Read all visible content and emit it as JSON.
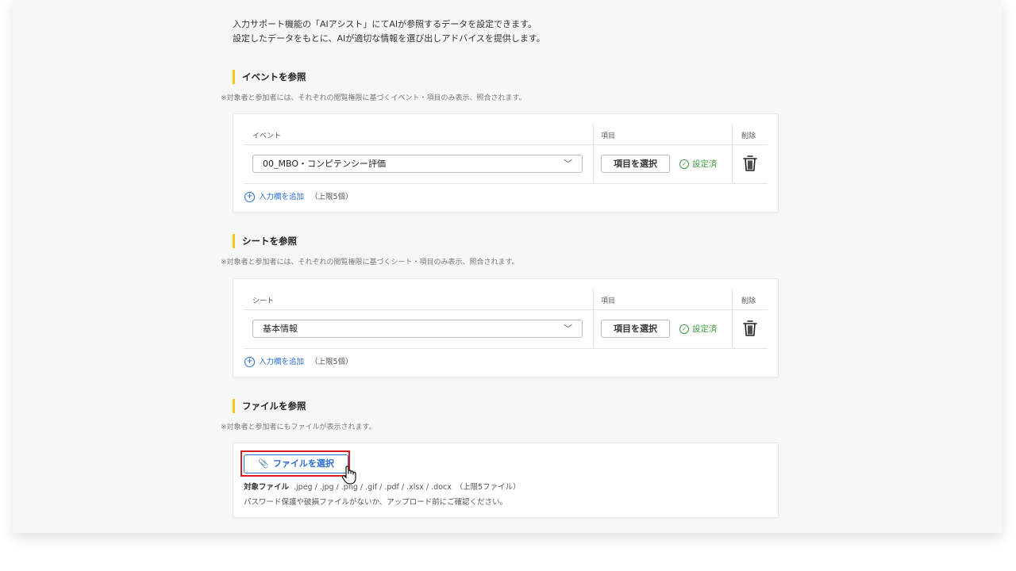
{
  "intro": {
    "line1": "入力サポート機能の「AIアシスト」にてAIが参照するデータを設定できます。",
    "line2": "設定したデータをもとに、AIが適切な情報を選び出しアドバイスを提供します。"
  },
  "event_section": {
    "title": "イベントを参照",
    "note": "※対象者と参加者には、それぞれの閲覧権限に基づくイベント・項目のみ表示、照合されます。",
    "col_main": "イベント",
    "col_item": "項目",
    "col_delete": "削除",
    "selected": "00_MBO・コンピテンシー評価",
    "item_button": "項目を選択",
    "status": "設定済",
    "add_label": "入力欄を追加",
    "limit": "（上限5個）"
  },
  "sheet_section": {
    "title": "シートを参照",
    "note": "※対象者と参加者には、それぞれの閲覧権限に基づくシート・項目のみ表示、照合されます。",
    "col_main": "シート",
    "col_item": "項目",
    "col_delete": "削除",
    "selected": "基本情報",
    "item_button": "項目を選択",
    "status": "設定済",
    "add_label": "入力欄を追加",
    "limit": "（上限5個）"
  },
  "file_section": {
    "title": "ファイルを参照",
    "note": "※対象者と参加者にもファイルが表示されます。",
    "button": "ファイルを選択",
    "types_label": "対象ファイル",
    "types": ".jpeg / .jpg / .png / .gif / .pdf / .xlsx / .docx　（上限5ファイル）",
    "warning": "パスワード保護や破損ファイルがないか、アップロード前にご確認ください。"
  },
  "colors": {
    "accent_yellow": "#f5c518",
    "link_blue": "#2a6fd6",
    "status_green": "#3a9b3f",
    "highlight_red": "#d31f1f"
  }
}
